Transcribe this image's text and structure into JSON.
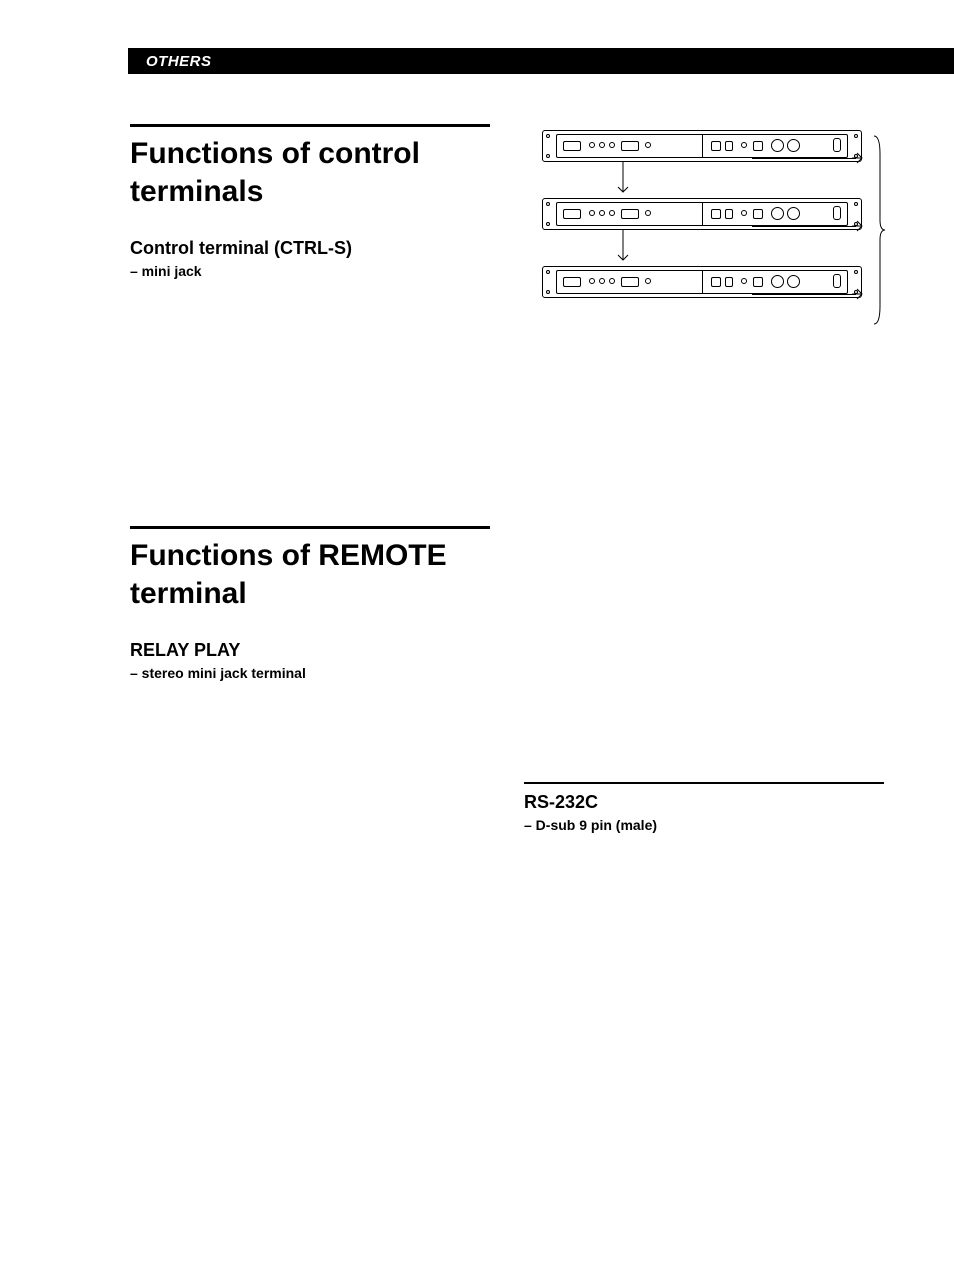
{
  "header": {
    "section": "OTHERS"
  },
  "section1": {
    "title_line1": "Functions of control",
    "title_line2": "terminals",
    "sub_title": "Control terminal (CTRL-S)",
    "sub_desc": "– mini jack"
  },
  "section2": {
    "title_line1": "Functions of REMOTE",
    "title_line2": "terminal",
    "sub_title": "RELAY PLAY",
    "sub_desc": "– stereo mini jack terminal"
  },
  "section3": {
    "sub_title": "RS-232C",
    "sub_desc": "– D-sub 9 pin (male)"
  }
}
